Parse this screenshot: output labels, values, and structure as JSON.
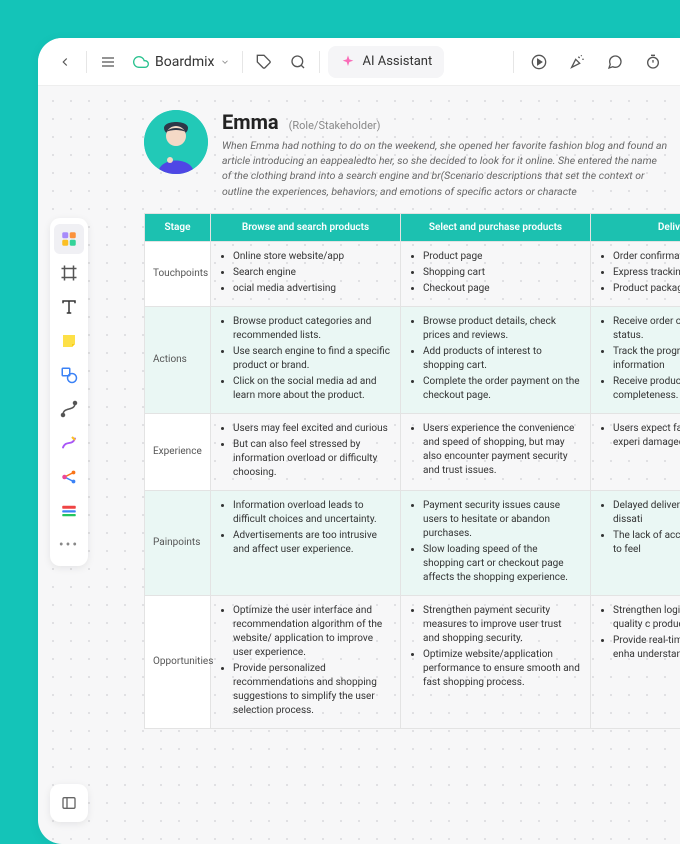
{
  "header": {
    "doc_title": "Boardmix",
    "ai_label": "AI Assistant"
  },
  "persona": {
    "name": "Emma",
    "role": "(Role/Stakeholder)",
    "desc": "When Emma had nothing to do on the weekend, she opened her favorite fashion blog and found an article introducing an eappealedto her, so she decided to look for it online. She entered the name of the clothing brand into a search engine and br(Scenario descriptions that set the context or outline the experiences, behaviors, and emotions of specific actors or characte"
  },
  "table": {
    "headers": [
      "Stage",
      "Browse and search products",
      "Select and purchase products",
      "Delivery and"
    ],
    "rows": [
      {
        "label": "Touchpoints",
        "cells": [
          [
            "Online store website/app",
            "Search engine",
            "ocial media advertising"
          ],
          [
            "Product page",
            "Shopping cart",
            "Checkout page"
          ],
          [
            "Order confirmation",
            "Express tracking inf",
            "Product packaging"
          ]
        ]
      },
      {
        "label": "Actions",
        "cells": [
          [
            "Browse product categories and recommended lists.",
            "Use search engine to find a specific product or brand.",
            "Click on the social media ad and learn more about the product."
          ],
          [
            "Browse product details, check prices and reviews.",
            "Add products of interest to shopping cart.",
            "Complete the order payment on the checkout page."
          ],
          [
            "Receive order confir check order status.",
            "Track the progress c tracking information",
            "Receive product anc completeness."
          ]
        ]
      },
      {
        "label": "Experience",
        "cells": [
          [
            "Users may feel excited and curious",
            "But can also feel stressed by information overload or difficulty choosing."
          ],
          [
            "Users experience the convenience and speed of shopping, but may also encounter payment security and trust issues."
          ],
          [
            "Users expect fast an but may also experi damaged packaging"
          ]
        ]
      },
      {
        "label": "Painpoints",
        "cells": [
          [
            "Information overload leads to difficult choices and uncertainty.",
            "Advertisements are too intrusive and affect user experience."
          ],
          [
            "Payment security issues cause users to hesitate or abandon purchases.",
            "Slow loading speed of the shopping cart or checkout page affects the shopping experience."
          ],
          [
            "Delayed delivery or leads to user dissati",
            "The lack of accurate causes users to feel"
          ]
        ]
      },
      {
        "label": "Opportunities",
        "cells": [
          [
            "Optimize the user interface and recommendation algorithm of the website/ application to improve user experience.",
            "Provide personalized recommendations and shopping suggestions to simplify the user selection process."
          ],
          [
            "Strengthen payment security measures to improve user trust and shopping security.",
            "Optimize website/application performance to ensure smooth and fast shopping process."
          ],
          [
            "Strengthen logistics packaging quality c products reach user",
            "Provide real-time de information to enha understanding and t"
          ]
        ]
      }
    ]
  }
}
